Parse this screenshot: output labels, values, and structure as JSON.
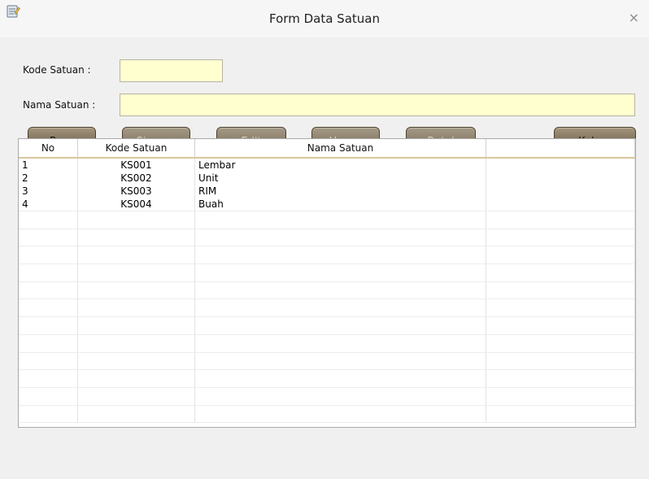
{
  "window": {
    "title": "Form Data Satuan",
    "close_glyph": "×",
    "app_icon": "notepad-icon"
  },
  "form": {
    "kode_label": "Kode Satuan :",
    "kode_value": "",
    "nama_label": "Nama Satuan :",
    "nama_value": ""
  },
  "buttons": {
    "baru": "Baru",
    "simpan": "Simpan",
    "edit": "Edit",
    "hapus": "Hapus",
    "batal": "Batal",
    "keluar": "Keluar"
  },
  "table": {
    "headers": [
      "No",
      "Kode Satuan",
      "Nama Satuan",
      ""
    ],
    "rows": [
      [
        "1",
        "KS001",
        "Lembar"
      ],
      [
        "2",
        "KS002",
        "Unit"
      ],
      [
        "3",
        "KS003",
        "RIM"
      ],
      [
        "4",
        "KS004",
        "Buah"
      ]
    ]
  },
  "colors": {
    "field_bg": "#ffffd0",
    "button_brown": "#7d7059",
    "header_underline": "#d9c79a"
  }
}
